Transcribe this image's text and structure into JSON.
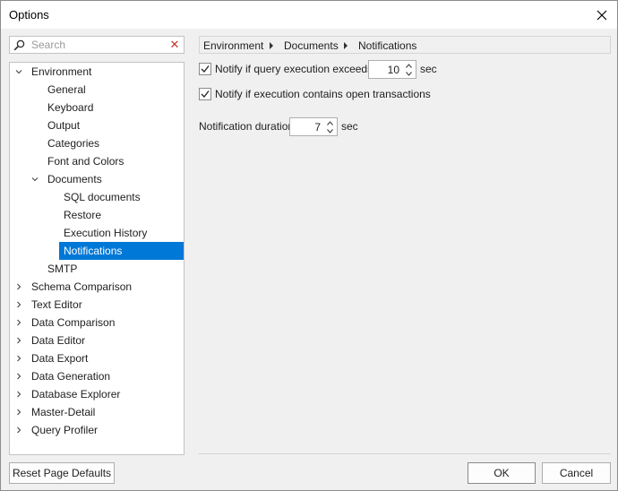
{
  "window": {
    "title": "Options",
    "close_icon": "close-icon"
  },
  "search": {
    "placeholder": "Search",
    "value": "",
    "icon": "magnifier-icon",
    "clear_icon": "clear-icon"
  },
  "tree": {
    "items": [
      {
        "label": "Environment",
        "expanded": true
      },
      {
        "label": "General"
      },
      {
        "label": "Keyboard"
      },
      {
        "label": "Output"
      },
      {
        "label": "Categories"
      },
      {
        "label": "Font and Colors"
      },
      {
        "label": "Documents",
        "expanded": true
      },
      {
        "label": "SQL documents"
      },
      {
        "label": "Restore"
      },
      {
        "label": "Execution History"
      },
      {
        "label": "Notifications",
        "selected": true
      },
      {
        "label": "SMTP"
      },
      {
        "label": "Schema Comparison",
        "expanded": false
      },
      {
        "label": "Text Editor",
        "expanded": false
      },
      {
        "label": "Data Comparison",
        "expanded": false
      },
      {
        "label": "Data Editor",
        "expanded": false
      },
      {
        "label": "Data Export",
        "expanded": false
      },
      {
        "label": "Data Generation",
        "expanded": false
      },
      {
        "label": "Database Explorer",
        "expanded": false
      },
      {
        "label": "Master-Detail",
        "expanded": false
      },
      {
        "label": "Query Profiler",
        "expanded": false
      }
    ]
  },
  "breadcrumb": {
    "items": [
      "Environment",
      "Documents",
      "Notifications"
    ]
  },
  "settings": {
    "query_exceeds": {
      "label": "Notify if query execution exceeds",
      "checked": true,
      "value": "10",
      "unit": "sec"
    },
    "open_transactions": {
      "label": "Notify if execution contains open transactions",
      "checked": true
    },
    "duration": {
      "label": "Notification duration",
      "value": "7",
      "unit": "sec"
    }
  },
  "buttons": {
    "reset": "Reset Page Defaults",
    "ok": "OK",
    "cancel": "Cancel"
  },
  "colors": {
    "selection": "#0078d7",
    "clear_x": "#c0392b",
    "dialog_bg": "#f0f0f0"
  }
}
